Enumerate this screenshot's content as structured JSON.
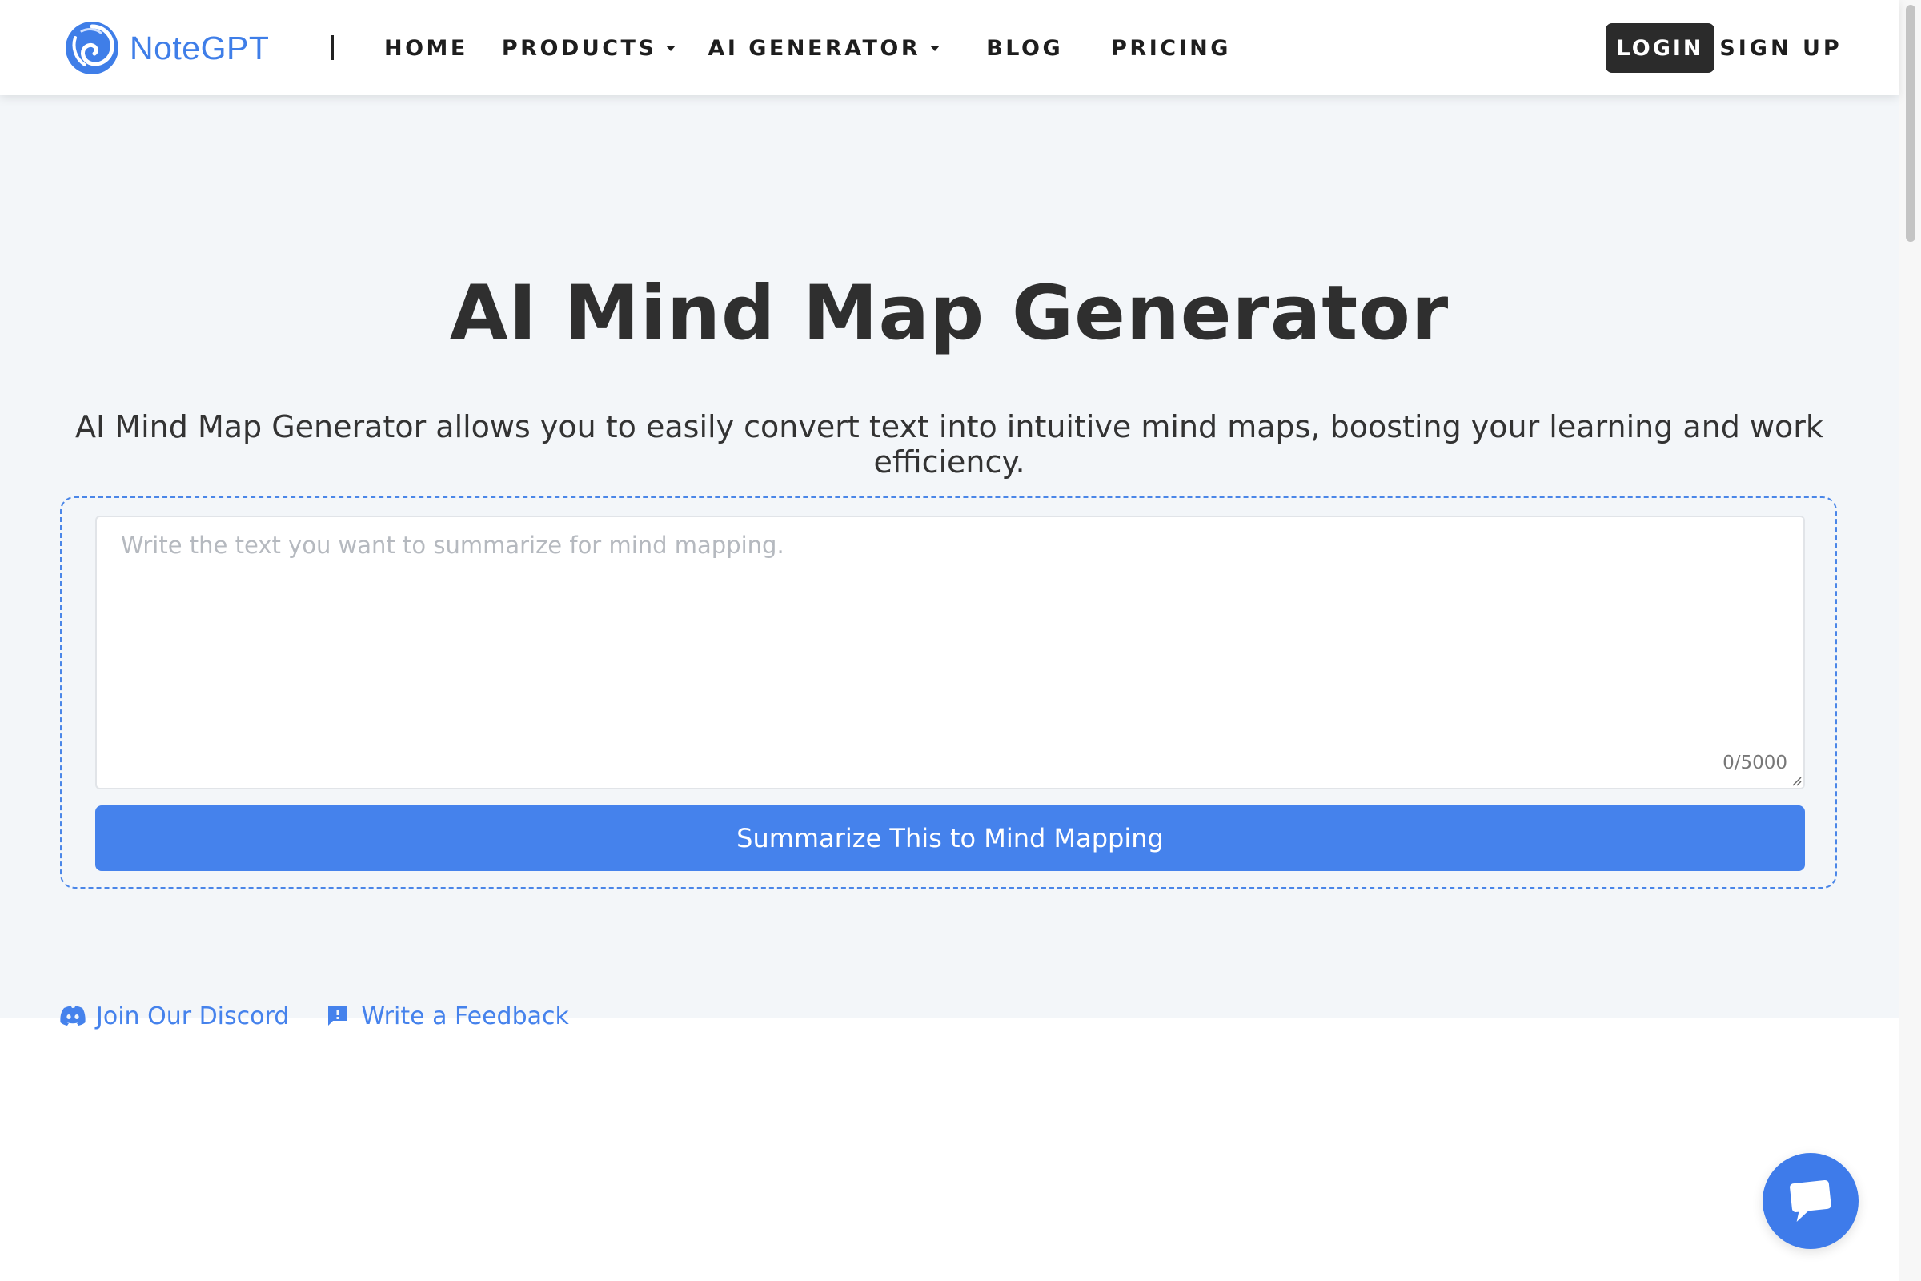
{
  "brand": {
    "name": "NoteGPT",
    "color": "#3f7ee8"
  },
  "nav": {
    "home": "HOME",
    "products": "PRODUCTS",
    "ai_generator": "AI GENERATOR",
    "blog": "BLOG",
    "pricing": "PRICING"
  },
  "auth": {
    "login": "LOGIN",
    "signup": "SIGN UP"
  },
  "hero": {
    "title": "AI Mind Map Generator",
    "subtitle": "AI Mind Map Generator allows you to easily convert text into intuitive mind maps, boosting your learning and work efficiency."
  },
  "input": {
    "placeholder": "Write the text you want to summarize for mind mapping.",
    "value": "",
    "counter": "0/5000"
  },
  "submit": {
    "label": "Summarize This to Mind Mapping",
    "color": "#4582ec"
  },
  "links": {
    "discord": {
      "label": "Join Our Discord",
      "icon": "discord-icon"
    },
    "feedback": {
      "label": "Write a Feedback",
      "icon": "feedback-icon"
    }
  },
  "chat": {
    "icon": "chat-bubble-icon"
  },
  "colors": {
    "accent": "#4582ec",
    "hero_bg": "#f3f6f9",
    "dark_button": "#2b2b2b"
  }
}
